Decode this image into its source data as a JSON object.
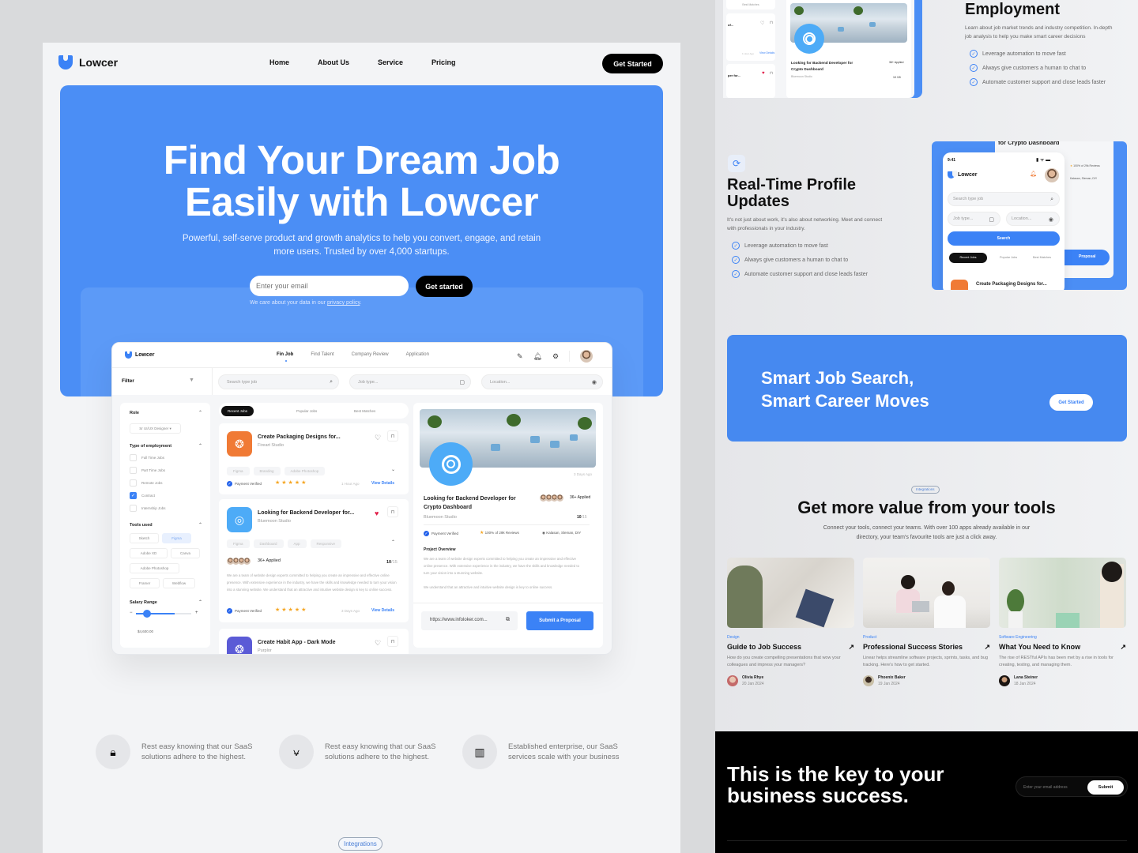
{
  "colors": {
    "accent": "#4b8ef5",
    "dark": "#000000",
    "heart": "#e11d48",
    "star": "#f5a623",
    "orange": "#f07a35",
    "lightblue": "#4dabf7",
    "purple": "#5b5bd6"
  },
  "nav": {
    "brand": "Lowcer",
    "links": [
      "Home",
      "About Us",
      "Service",
      "Pricing"
    ],
    "cta": "Get Started"
  },
  "hero": {
    "title_line1": "Find Your Dream Job",
    "title_line2": "Easily with Lowcer",
    "subtitle": "Powerful, self-serve product and growth analytics to help you convert, engage, and retain more users. Trusted by over 4,000 startups.",
    "email_placeholder": "Enter your email",
    "cta": "Get started",
    "privacy_prefix": "We care about your data in our ",
    "privacy_link": "privacy policy",
    "privacy_suffix": "."
  },
  "dashboard": {
    "brand": "Lowcer",
    "tabs": [
      "Fin Job",
      "Find Talent",
      "Company Review",
      "Application"
    ],
    "filter_label": "Filter",
    "search_placeholder": "Search type job",
    "jobtype_placeholder": "Job type...",
    "location_placeholder": "Location...",
    "sidebar": {
      "role_label": "Role",
      "role_value": "Sr UI/UX Designer",
      "employment_label": "Type of employment",
      "employment": [
        {
          "label": "Full Time Jobs",
          "checked": false
        },
        {
          "label": "Part Time Jobs",
          "checked": false
        },
        {
          "label": "Remote Jobs",
          "checked": false
        },
        {
          "label": "Contract",
          "checked": true
        },
        {
          "label": "Internship Jobs",
          "checked": false
        }
      ],
      "tools_label": "Tools used",
      "tools": [
        "Sketch",
        "Figma",
        "Adobe XD",
        "Canva",
        "Adobe Photoshop",
        "Framer",
        "Webflow"
      ],
      "tools_selected": "Figma",
      "salary_label": "Salary Range",
      "salary_value": "$4,600.00",
      "salary_fraction": 0.2
    },
    "job_tabs": [
      "Recent Jobs",
      "Popular Jobs",
      "Best Matches"
    ],
    "jobs": [
      {
        "title": "Create Packaging Designs for...",
        "company": "Fireart Studio",
        "tags": [
          "Figma",
          "Branding",
          "Adobe Photoshop"
        ],
        "verified": "Payment Verified",
        "rating": 5,
        "ago": "1 Hour Ago",
        "action": "View Details",
        "liked": false
      },
      {
        "title": "Looking for Backend Developer for...",
        "company": "Bluemoon Studio",
        "tags": [
          "Figma",
          "Dashboard",
          "App",
          "Responsive"
        ],
        "applied": "36+ Applied",
        "count": "10",
        "count_total": "/15",
        "desc": "We are a team of website design experts committed to helping you create an impressive and effective online presence. With extensive experience in the industry, we have the skills and knowledge needed to turn your vision into a stunning website. We understand that an attractive and intuitive website design is key to online success.",
        "verified": "Payment Verified",
        "rating": 5,
        "ago": "3 Days Ago",
        "action": "View Details",
        "liked": true
      },
      {
        "title": "Create Habit App - Dark Mode",
        "company": "Purplor",
        "liked": false
      }
    ],
    "detail": {
      "ago": "3 Days Ago",
      "title": "Looking for Backend Developer for Crypto Dashboard",
      "company": "Bluemoon Studio",
      "applied": "36+ Applied",
      "count": "10",
      "count_total": "/15",
      "verified": "Payment Verified",
      "reviews": "100% of 29k Reviews",
      "location": "Kalasan, Sleman, DIY",
      "overview_label": "Project Overview",
      "overview_p1": "We are a team of website design experts committed to helping you create an impressive and effective online presence. With extensive experience in the industry, we have the skills and knowledge needed to turn your vision into a stunning website.",
      "overview_p2": "We understand that an attractive and intuitive website design is key to online success.",
      "url": "https://www.infoloker.com...",
      "submit": "Submit a Proposal"
    }
  },
  "features": [
    {
      "icon": "lock-icon",
      "text": "Rest easy knowing that our SaaS solutions adhere to the highest."
    },
    {
      "icon": "vector-pen-icon",
      "text": "Rest easy knowing that our SaaS solutions adhere to the highest."
    },
    {
      "icon": "bar-chart-icon",
      "text": "Established enterprise, our SaaS services scale with your business"
    }
  ],
  "integrations_pill": "Integrations",
  "right": {
    "employment": {
      "title": "Employment",
      "desc": "Learn about job market trends and industry competition. In-depth job analysis to help you make smart career decisions",
      "checks": [
        "Leverage automation to move fast",
        "Always give customers a human to chat to",
        "Automate customer support and close leads faster"
      ],
      "mini_best_matches": "Best Matches",
      "mini_title": "Looking for Backend Developer for Crypto Dashboard",
      "mini_company": "Bluemoon Studio",
      "mini_applied": "36+ Applied",
      "mini_count": "10 /15",
      "mini_view": "View Details",
      "mini_ago": "1 Hour Ago"
    },
    "profile": {
      "title_line1": "Real-Time Profile",
      "title_line2": "Updates",
      "desc": "It's not just about work, it's also about networking. Meet and connect with professionals in your industry.",
      "checks": [
        "Leverage automation to move fast",
        "Always give customers a human to chat to",
        "Automate customer support and close leads faster"
      ],
      "phone": {
        "time": "9:41",
        "brand": "Lowcer",
        "search_placeholder": "Search type job",
        "jobtype_placeholder": "Job type...",
        "location_placeholder": "Location...",
        "search_btn": "Search",
        "tabs": [
          "Recent Jobs",
          "Popular Jobs",
          "Best Matches"
        ],
        "job_title": "Create Packaging Designs for...",
        "behind_title": "for Crypto Dashboard",
        "behind_reviews": "100% of 29k Reviews",
        "behind_location": "Kalasan, Sleman, DIY",
        "behind_proposal": "Proposal"
      }
    },
    "smart": {
      "line1": "Smart Job Search,",
      "line2": "Smart Career Moves",
      "cta": "Get Started"
    },
    "integrations": {
      "pill": "Integrations",
      "title": "Get more value from your tools",
      "desc": "Connect your tools, connect your teams. With over 100 apps already available in our directory, your team's favourite tools are just a click away."
    },
    "blogs": [
      {
        "category": "Design",
        "title": "Guide to Job Success",
        "desc": "How do you create compelling presentations that wow your colleagues and impress your managers?",
        "author": "Olivia Rhye",
        "date": "20 Jan 2024"
      },
      {
        "category": "Product",
        "title": "Professional Success Stories",
        "desc": "Linear helps streamline software projects, sprints, tasks, and bug tracking. Here's how to get started.",
        "author": "Phoenix Baker",
        "date": "19 Jan 2024"
      },
      {
        "category": "Software Engineering",
        "title": "What You Need to Know",
        "desc": "The rise of RESTful APIs has been met by a rise in tools for creating, testing, and managing them.",
        "author": "Lana Steiner",
        "date": "18 Jan 2024"
      }
    ],
    "footer": {
      "line1": "This is the key to your",
      "line2": "business success.",
      "email_placeholder": "Enter your email address",
      "submit": "Submit"
    }
  }
}
